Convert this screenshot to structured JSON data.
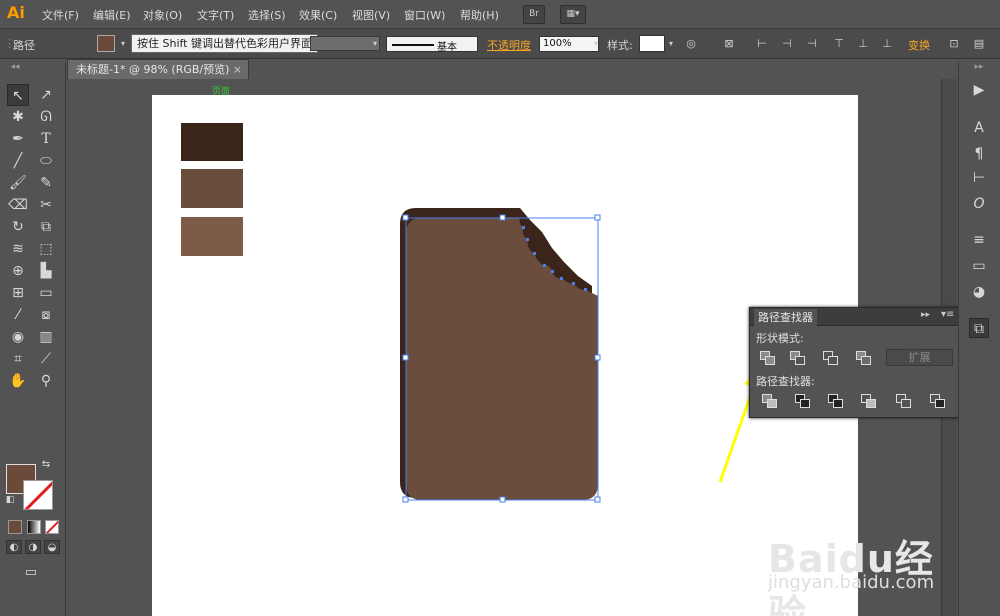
{
  "app": {
    "logo": "Ai"
  },
  "menu": [
    "文件(F)",
    "编辑(E)",
    "对象(O)",
    "文字(T)",
    "选择(S)",
    "效果(C)",
    "视图(V)",
    "窗口(W)",
    "帮助(H)"
  ],
  "menubar_buttons": {
    "bridge": "Br"
  },
  "control_bar": {
    "object_type": "路径",
    "tooltip": "按住 Shift 键调出替代色彩用户界面",
    "stroke_style": "基本",
    "opacity_label": "不透明度",
    "opacity_value": "100%",
    "style_label": "样式:",
    "transform_label": "变换"
  },
  "document_tab": {
    "title": "未标题-1* @ 98% (RGB/预览)",
    "close": "×"
  },
  "artboard": {
    "label": "页面"
  },
  "swatches": [
    {
      "name": "dark-brown",
      "color": "#3b251b"
    },
    {
      "name": "medium-brown",
      "color": "#6b4d3d"
    },
    {
      "name": "light-brown",
      "color": "#7d5b47"
    }
  ],
  "shape": {
    "back_color": "#3b251b",
    "front_color": "#6b4d3d",
    "selection_color": "#4a7ff0"
  },
  "toolbar": {
    "fill_color": "#6b4a3a",
    "stroke_color": "none"
  },
  "pathfinder": {
    "tab_label": "路径查找器",
    "shape_modes_label": "形状模式:",
    "pathfinders_label": "路径查找器:",
    "expand_label": "扩展"
  },
  "annotation": {
    "arrow_color": "#ffff00"
  },
  "watermark": {
    "brand": "Baidu经验",
    "url": "jingyan.baidu.com"
  }
}
